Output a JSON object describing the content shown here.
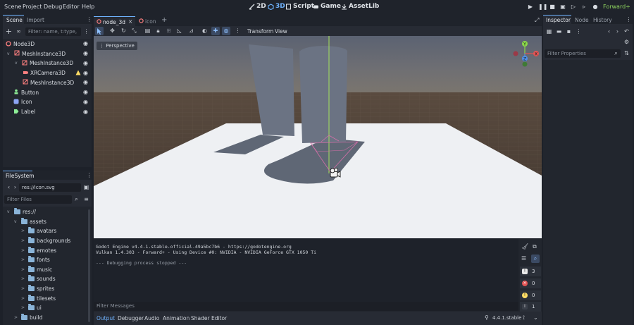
{
  "menu": [
    "Scene",
    "Project",
    "Debug",
    "Editor",
    "Help"
  ],
  "workspaces": [
    {
      "label": "2D",
      "icon": "2d-icon",
      "active": false
    },
    {
      "label": "3D",
      "icon": "3d-icon",
      "active": true
    },
    {
      "label": "Script",
      "icon": "script-icon",
      "active": false
    },
    {
      "label": "Game",
      "icon": "game-icon",
      "active": false
    },
    {
      "label": "AssetLib",
      "icon": "assetlib-icon",
      "active": false
    }
  ],
  "renderer": "Forward+",
  "scene_dock": {
    "tabs": [
      "Scene",
      "Import"
    ],
    "filter_placeholder": "Filter: name, t:type,",
    "tree": [
      {
        "label": "Node3D",
        "icon": "node3d-icon",
        "indent": 0,
        "arrow": "",
        "warning": false
      },
      {
        "label": "MeshInstance3D",
        "icon": "mesh-icon",
        "indent": 1,
        "arrow": "v",
        "warning": false
      },
      {
        "label": "MeshInstance3D",
        "icon": "mesh-icon",
        "indent": 2,
        "arrow": "v",
        "warning": false
      },
      {
        "label": "XRCamera3D",
        "icon": "xrcamera-icon",
        "indent": 3,
        "arrow": "",
        "warning": true
      },
      {
        "label": "MeshInstance3D",
        "icon": "mesh-icon",
        "indent": 3,
        "arrow": "",
        "warning": false
      },
      {
        "label": "Button",
        "icon": "button-icon",
        "indent": 1,
        "arrow": "",
        "warning": false
      },
      {
        "label": "Icon",
        "icon": "sprite-icon",
        "indent": 1,
        "arrow": "",
        "warning": false
      },
      {
        "label": "Label",
        "icon": "label-icon",
        "indent": 1,
        "arrow": "",
        "warning": false
      }
    ]
  },
  "filesystem": {
    "title": "FileSystem",
    "path": "res://icon.svg",
    "filter_placeholder": "Filter Files",
    "items": [
      {
        "label": "res://",
        "indent": 0,
        "arrow": "v"
      },
      {
        "label": "assets",
        "indent": 1,
        "arrow": "v"
      },
      {
        "label": "avatars",
        "indent": 2,
        "arrow": ">"
      },
      {
        "label": "backgrounds",
        "indent": 2,
        "arrow": ">"
      },
      {
        "label": "emotes",
        "indent": 2,
        "arrow": ">"
      },
      {
        "label": "fonts",
        "indent": 2,
        "arrow": ">"
      },
      {
        "label": "music",
        "indent": 2,
        "arrow": ">"
      },
      {
        "label": "sounds",
        "indent": 2,
        "arrow": ">"
      },
      {
        "label": "sprites",
        "indent": 2,
        "arrow": ">"
      },
      {
        "label": "tilesets",
        "indent": 2,
        "arrow": ">"
      },
      {
        "label": "ui",
        "indent": 2,
        "arrow": ">"
      },
      {
        "label": "build",
        "indent": 1,
        "arrow": ">"
      }
    ]
  },
  "editor_tabs": [
    {
      "label": "node_3d",
      "active": true
    },
    {
      "label": "icon",
      "active": false
    }
  ],
  "toolbar": {
    "transform_label": "Transform",
    "view_label": "View"
  },
  "viewport": {
    "perspective_label": "Perspective",
    "gizmo": {
      "y": "Y",
      "x": "X",
      "z": "Z"
    }
  },
  "output": {
    "lines": [
      "Godot Engine v4.4.1.stable.official.49a5bc7b6 - https://godotengine.org",
      "Vulkan 1.4.303 - Forward+ - Using Device #0: NVIDIA - NVIDIA GeForce GTX 1050 Ti",
      "",
      "--- Debugging process stopped ---"
    ],
    "filter_placeholder": "Filter Messages",
    "counts": {
      "messages": "3",
      "errors": "0",
      "warnings": "0",
      "info": "1"
    }
  },
  "bottom_tabs": [
    "Output",
    "Debugger",
    "Audio",
    "Animation",
    "Shader Editor"
  ],
  "version": "4.4.1.stable",
  "inspector": {
    "tabs": [
      "Inspector",
      "Node",
      "History"
    ],
    "filter_placeholder": "Filter Properties"
  }
}
